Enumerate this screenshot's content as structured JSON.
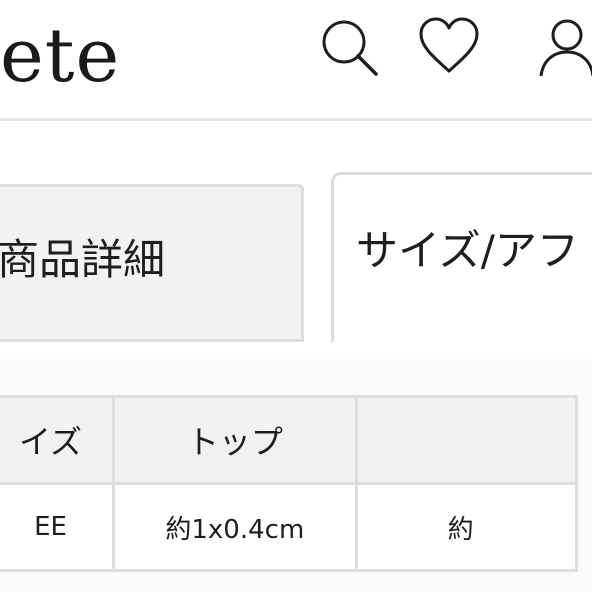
{
  "header": {
    "logo_text": "ete",
    "icons": [
      "search-icon",
      "heart-icon",
      "user-icon"
    ]
  },
  "tabs": [
    {
      "label": "商品詳細",
      "active": false
    },
    {
      "label": "サイズ/アフ",
      "active": true
    }
  ],
  "size_table": {
    "headers": [
      "イズ",
      "トップ",
      ""
    ],
    "rows": [
      [
        "EE",
        "約1x0.4cm",
        "約"
      ]
    ]
  },
  "colors": {
    "text": "#1e1e1e",
    "border": "#dedede",
    "tab_inactive_bg": "#f2f2f2",
    "header_cell_bg": "#f1f1f1"
  }
}
